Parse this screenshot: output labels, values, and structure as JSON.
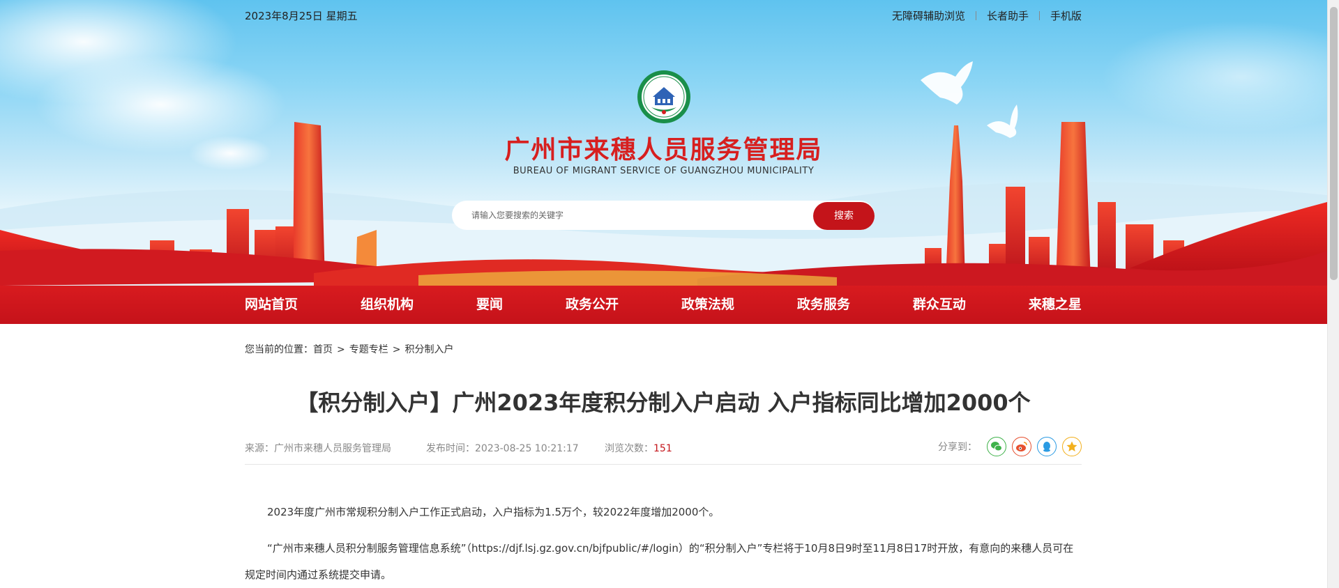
{
  "topbar": {
    "date": "2023年8月25日 星期五",
    "links": [
      "无障碍辅助浏览",
      "长者助手",
      "手机版"
    ]
  },
  "header": {
    "logo_icon": "agency-seal-icon",
    "title": "广州市来穗人员服务管理局",
    "subtitle": "BUREAU OF MIGRANT SERVICE OF GUANGZHOU MUNICIPALITY"
  },
  "search": {
    "placeholder": "请输入您要搜索的关键字",
    "button_label": "搜索"
  },
  "nav": {
    "items": [
      "网站首页",
      "组织机构",
      "要闻",
      "政务公开",
      "政策法规",
      "政务服务",
      "群众互动",
      "来穗之星"
    ]
  },
  "breadcrumb": {
    "prefix": "您当前的位置：",
    "items": [
      "首页",
      "专题专栏",
      "积分制入户"
    ],
    "separator": ">"
  },
  "article": {
    "title": "【积分制入户】广州2023年度积分制入户启动 入户指标同比增加2000个",
    "meta": {
      "source": "来源：广州市来穗人员服务管理局",
      "publish_time": "发布时间：2023-08-25 10:21:17",
      "views_label": "浏览次数：",
      "views": "151",
      "share_label": "分享到："
    },
    "share_icons": [
      "wechat-icon",
      "weibo-icon",
      "qq-icon",
      "qzone-icon"
    ],
    "paragraphs": [
      "2023年度广州市常规积分制入户工作正式启动，入户指标为1.5万个，较2022年度增加2000个。",
      "“广州市来穗人员积分制服务管理信息系统”（https://djf.lsj.gz.gov.cn/bjfpublic/#/login）的“积分制入户”专栏将于10月8日9时至11月8日17时开放，有意向的来穗人员可在规定时间内通过系统提交申请。"
    ]
  },
  "colors": {
    "brand_red": "#c4141a",
    "title_red": "#d71f1f",
    "sky_blue": "#5fc3ef"
  }
}
